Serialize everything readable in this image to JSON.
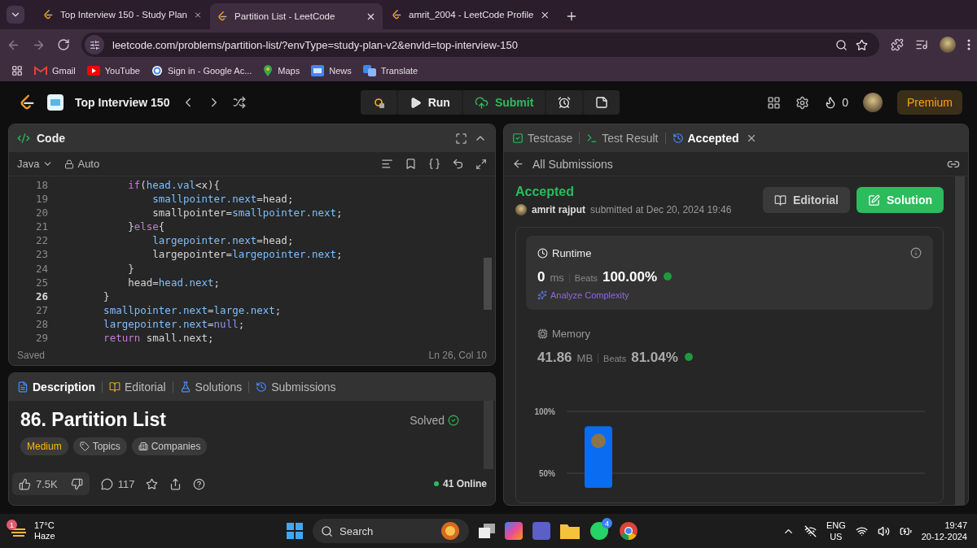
{
  "browser": {
    "tabs": [
      {
        "title": "Top Interview 150 - Study Plan",
        "selected": false
      },
      {
        "title": "Partition List - LeetCode",
        "selected": true
      },
      {
        "title": "amrit_2004 - LeetCode Profile",
        "selected": false
      }
    ],
    "url": "leetcode.com/problems/partition-list/?envType=study-plan-v2&envId=top-interview-150",
    "bookmarks": [
      "Gmail",
      "YouTube",
      "Sign in - Google Ac...",
      "Maps",
      "News",
      "Translate"
    ]
  },
  "header": {
    "study_plan": "Top Interview 150",
    "run": "Run",
    "submit": "Submit",
    "streak": "0",
    "premium": "Premium"
  },
  "code_panel": {
    "title": "Code",
    "language": "Java",
    "mode": "Auto",
    "status": "Saved",
    "cursor": "Ln 26, Col 10",
    "lines": [
      {
        "number": "18",
        "active": false,
        "tokens": [
          {
            "text": "        if",
            "kind": "keyword"
          },
          {
            "text": "(",
            "kind": "plain"
          },
          {
            "text": "head.val",
            "kind": "ident"
          },
          {
            "text": "<x){",
            "kind": "plain"
          }
        ]
      },
      {
        "number": "19",
        "active": false,
        "tokens": [
          {
            "text": "            smallpointer.next",
            "kind": "ident"
          },
          {
            "text": "=head;",
            "kind": "plain"
          }
        ]
      },
      {
        "number": "20",
        "active": false,
        "tokens": [
          {
            "text": "            smallpointer=",
            "kind": "plain"
          },
          {
            "text": "smallpointer.next",
            "kind": "ident"
          },
          {
            "text": ";",
            "kind": "plain"
          }
        ]
      },
      {
        "number": "21",
        "active": false,
        "tokens": [
          {
            "text": "        }",
            "kind": "plain"
          },
          {
            "text": "else",
            "kind": "keyword"
          },
          {
            "text": "{",
            "kind": "plain"
          }
        ]
      },
      {
        "number": "22",
        "active": false,
        "tokens": [
          {
            "text": "            largepointer.next",
            "kind": "ident"
          },
          {
            "text": "=head;",
            "kind": "plain"
          }
        ]
      },
      {
        "number": "23",
        "active": false,
        "tokens": [
          {
            "text": "            largepointer=",
            "kind": "plain"
          },
          {
            "text": "largepointer.next",
            "kind": "ident"
          },
          {
            "text": ";",
            "kind": "plain"
          }
        ]
      },
      {
        "number": "24",
        "active": false,
        "tokens": [
          {
            "text": "        }",
            "kind": "plain"
          }
        ]
      },
      {
        "number": "25",
        "active": false,
        "tokens": [
          {
            "text": "        head=",
            "kind": "plain"
          },
          {
            "text": "head.next",
            "kind": "ident"
          },
          {
            "text": ";",
            "kind": "plain"
          }
        ]
      },
      {
        "number": "26",
        "active": true,
        "tokens": [
          {
            "text": "    }",
            "kind": "plain"
          }
        ]
      },
      {
        "number": "27",
        "active": false,
        "tokens": [
          {
            "text": "    smallpointer.next",
            "kind": "ident"
          },
          {
            "text": "=",
            "kind": "plain"
          },
          {
            "text": "large.next",
            "kind": "ident"
          },
          {
            "text": ";",
            "kind": "plain"
          }
        ]
      },
      {
        "number": "28",
        "active": false,
        "tokens": [
          {
            "text": "    largepointer.next",
            "kind": "ident"
          },
          {
            "text": "=",
            "kind": "plain"
          },
          {
            "text": "null",
            "kind": "literal"
          },
          {
            "text": ";",
            "kind": "plain"
          }
        ]
      },
      {
        "number": "29",
        "active": false,
        "tokens": [
          {
            "text": "    return",
            "kind": "keyword"
          },
          {
            "text": " small.next;",
            "kind": "plain"
          }
        ]
      }
    ]
  },
  "description_panel": {
    "tabs": [
      {
        "label": "Description",
        "selected": true
      },
      {
        "label": "Editorial",
        "selected": false
      },
      {
        "label": "Solutions",
        "selected": false
      },
      {
        "label": "Submissions",
        "selected": false
      }
    ],
    "problem_title": "86. Partition List",
    "status": "Solved",
    "tags": [
      "Medium",
      "Topics",
      "Companies"
    ],
    "likes": "7.5K",
    "comments": "117",
    "online": "41 Online"
  },
  "result_panel": {
    "tabs": [
      {
        "label": "Testcase",
        "selected": false
      },
      {
        "label": "Test Result",
        "selected": false
      },
      {
        "label": "Accepted",
        "selected": true
      }
    ],
    "back_label": "All Submissions",
    "verdict": "Accepted",
    "author": "amrit rajput",
    "submitted": "submitted at Dec 20, 2024 19:46",
    "editorial_button": "Editorial",
    "solution_button": "Solution",
    "metrics": [
      {
        "title": "Runtime",
        "value": "0",
        "unit": "ms",
        "beats_label": "Beats",
        "beats": "100.00%",
        "analyze": "Analyze Complexity",
        "selected": true
      },
      {
        "title": "Memory",
        "value": "41.86",
        "unit": "MB",
        "beats_label": "Beats",
        "beats": "81.04%",
        "selected": false
      }
    ],
    "chart_data": {
      "type": "bar",
      "values": [
        88
      ],
      "ylim": [
        38,
        100
      ],
      "yticks": [
        {
          "value": 50,
          "label": "50%"
        },
        {
          "value": 100,
          "label": "100%"
        }
      ]
    }
  },
  "taskbar": {
    "weather_badge": "1",
    "temperature": "17°C",
    "condition": "Haze",
    "search": "Search",
    "whatsapp_badge": "4",
    "language": "ENG",
    "region": "US",
    "time": "19:47",
    "date": "20-12-2024"
  }
}
